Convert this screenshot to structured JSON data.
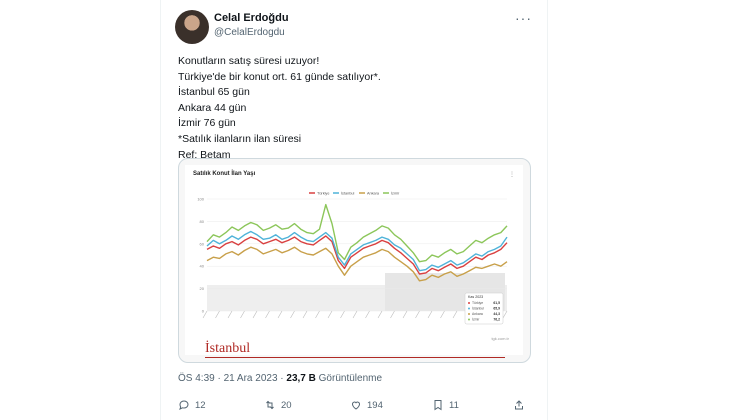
{
  "user": {
    "name": "Celal Erdoğdu",
    "handle": "@CelalErdogdu"
  },
  "tweet_lines": [
    "Konutların satış süresi uzuyor!",
    "Türkiye'de bir konut ort. 61 günde satılıyor*.",
    "İstanbul 65 gün",
    "Ankara 44 gün",
    "İzmir 76 gün",
    "*Satılık ilanların ilan süresi",
    "Ref: Betam"
  ],
  "meta": {
    "time": "ÖS 4:39 · 21 Ara 2023 · ",
    "views_value": "23,7 B",
    "views_label": " Görüntülenme"
  },
  "stats": {
    "replies": "12",
    "retweets": "20",
    "likes": "194",
    "bookmarks": "11"
  },
  "embedded_chart": {
    "title": "Satılık Konut İlan Yaşı",
    "logo_text": "İstanbul",
    "credit": "tgk.com.tr",
    "legend": [
      "Türkiye",
      "İstanbul",
      "Ankara",
      "İzmir"
    ],
    "colors": {
      "turkiye": "#d94040",
      "istanbul": "#4fb3d9",
      "ankara": "#c8a04a",
      "izmir": "#8cc65a"
    },
    "tooltip": {
      "title": "Kas 2023",
      "rows": [
        {
          "name": "Türkiye",
          "value": "61,5"
        },
        {
          "name": "İstanbul",
          "value": "65,9"
        },
        {
          "name": "Ankara",
          "value": "44,3"
        },
        {
          "name": "İzmir",
          "value": "76,2"
        }
      ]
    },
    "y_ticks": [
      "100",
      "80",
      "60",
      "40",
      "20",
      "0"
    ],
    "series": {
      "turkiye": [
        55,
        58,
        56,
        60,
        62,
        59,
        63,
        66,
        64,
        60,
        62,
        64,
        61,
        63,
        66,
        62,
        60,
        59,
        63,
        67,
        62,
        45,
        38,
        48,
        52,
        56,
        58,
        60,
        63,
        61,
        56,
        52,
        47,
        42,
        33,
        34,
        38,
        36,
        39,
        42,
        38,
        40,
        44,
        48,
        46,
        50,
        52,
        55,
        61
      ],
      "istanbul": [
        58,
        63,
        60,
        63,
        67,
        64,
        68,
        71,
        68,
        64,
        65,
        68,
        64,
        66,
        70,
        66,
        63,
        62,
        66,
        70,
        65,
        48,
        41,
        51,
        55,
        59,
        61,
        63,
        66,
        64,
        59,
        56,
        51,
        46,
        36,
        37,
        41,
        39,
        42,
        45,
        41,
        43,
        47,
        51,
        49,
        53,
        55,
        58,
        66
      ],
      "ankara": [
        45,
        48,
        47,
        51,
        53,
        50,
        54,
        57,
        55,
        51,
        53,
        55,
        52,
        54,
        57,
        53,
        51,
        50,
        53,
        56,
        51,
        40,
        32,
        40,
        44,
        48,
        50,
        52,
        55,
        53,
        48,
        44,
        40,
        35,
        27,
        28,
        32,
        30,
        33,
        35,
        31,
        33,
        36,
        39,
        38,
        40,
        42,
        40,
        44
      ],
      "izmir": [
        62,
        68,
        66,
        70,
        75,
        72,
        76,
        79,
        77,
        72,
        74,
        77,
        73,
        74,
        78,
        73,
        70,
        69,
        73,
        95,
        78,
        52,
        46,
        57,
        61,
        66,
        69,
        72,
        76,
        74,
        68,
        64,
        58,
        52,
        44,
        45,
        50,
        48,
        52,
        55,
        51,
        53,
        58,
        63,
        61,
        65,
        68,
        70,
        76
      ]
    }
  }
}
